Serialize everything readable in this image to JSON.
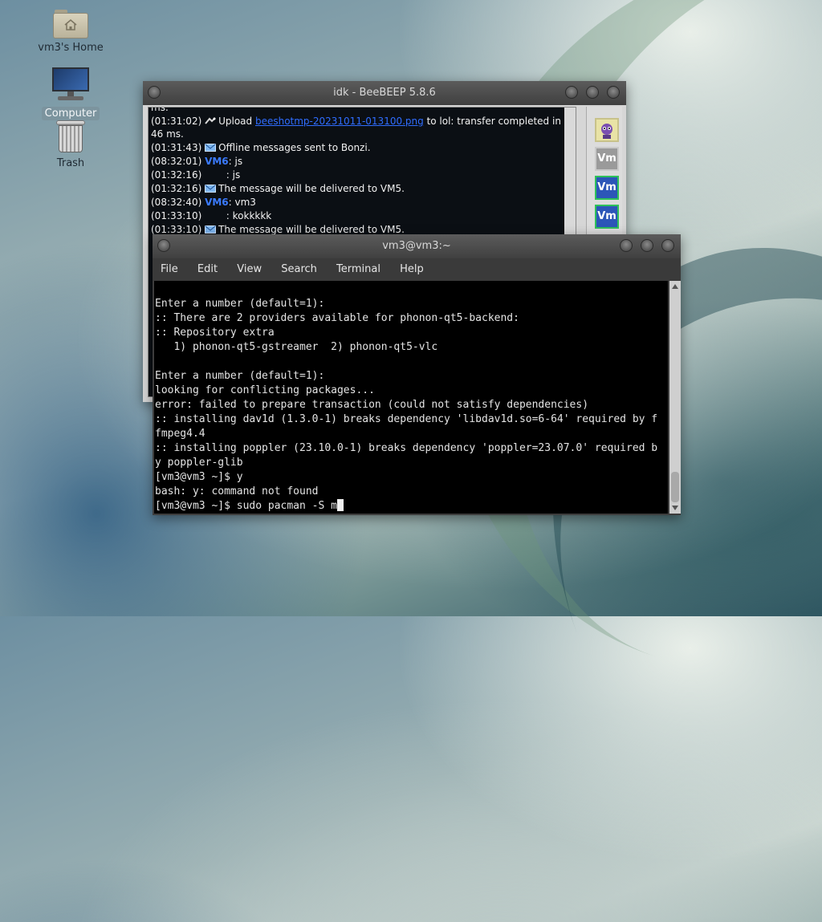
{
  "desktop": {
    "icons": [
      {
        "label": "vm3's Home"
      },
      {
        "label": "Computer"
      },
      {
        "label": "Trash"
      }
    ]
  },
  "beebeep": {
    "title": "idk - BeeBEEP 5.8.6",
    "messages": [
      {
        "time": "",
        "text": "ms."
      },
      {
        "time": "(01:31:02)",
        "pre": "Upload ",
        "link": "beeshotmp-20231011-013100.png",
        "post": " to lol: transfer completed in 46 ms.",
        "icon": "upload-icon"
      },
      {
        "time": "(01:31:43)",
        "text": "Offline messages sent to Bonzi.",
        "icon": "envelope-icon"
      },
      {
        "time": "(08:32:01)",
        "nick": "VM6",
        "text": ": js"
      },
      {
        "time": "(01:32:16)",
        "text": "       : js"
      },
      {
        "time": "(01:32:16)",
        "text": "The message will be delivered to VM5.",
        "icon": "envelope-icon"
      },
      {
        "time": "(08:32:40)",
        "nick": "VM6",
        "text": ": vm3"
      },
      {
        "time": "(01:33:10)",
        "text": "       : kokkkkk"
      },
      {
        "time": "(01:33:10)",
        "text": "The message will be delivered to VM5.",
        "icon": "envelope-icon"
      }
    ],
    "avatars": [
      {
        "label": "",
        "kind": "bonzi"
      },
      {
        "label": "Vm",
        "kind": "grey"
      },
      {
        "label": "Vm",
        "kind": "blue"
      },
      {
        "label": "Vm",
        "kind": "blue"
      }
    ]
  },
  "terminal": {
    "title": "vm3@vm3:~",
    "menu": [
      "File",
      "Edit",
      "View",
      "Search",
      "Terminal",
      "Help"
    ],
    "lines": [
      "Enter a number (default=1):",
      ":: There are 2 providers available for phonon-qt5-backend:",
      ":: Repository extra",
      "   1) phonon-qt5-gstreamer  2) phonon-qt5-vlc",
      "",
      "Enter a number (default=1):",
      "looking for conflicting packages...",
      "error: failed to prepare transaction (could not satisfy dependencies)",
      ":: installing dav1d (1.3.0-1) breaks dependency 'libdav1d.so=6-64' required by f",
      "fmpeg4.4",
      ":: installing poppler (23.10.0-1) breaks dependency 'poppler=23.07.0' required b",
      "y poppler-glib",
      "[vm3@vm3 ~]$ y",
      "bash: y: command not found"
    ],
    "prompt": "[vm3@vm3 ~]$ sudo pacman -S m"
  }
}
